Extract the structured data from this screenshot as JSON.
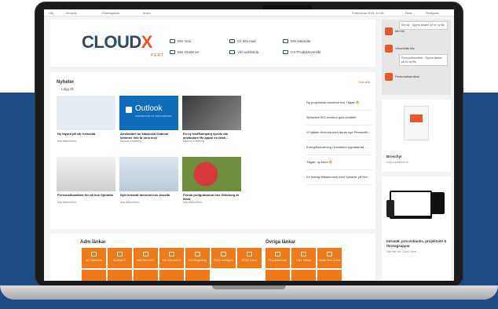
{
  "topbar": {
    "home": "Hej",
    "item1": "Intranät",
    "item2": "Företagsinfo",
    "item3": "Index",
    "right1": "Publicerad 2021-10-08",
    "right2": "Dela",
    "right3": "Redigera"
  },
  "header": {
    "logo_main": "CLOUD",
    "logo_x": "X",
    "logo_sub": "PERT",
    "quicklinks": [
      {
        "label": "Min mail",
        "icon": "mail-icon"
      },
      {
        "label": "Cli Info mail",
        "icon": "mail-icon"
      },
      {
        "label": "Min kalender",
        "icon": "calendar-icon"
      },
      {
        "label": "Min OneDrive",
        "icon": "cloud-icon"
      },
      {
        "label": "Vår webbsida",
        "icon": "globe-icon"
      },
      {
        "label": "CX Produktöversikt",
        "icon": "grid-icon"
      }
    ]
  },
  "news": {
    "title": "Nyheter",
    "add_label": "Lägg till",
    "see_all": "Visa alla",
    "tiles": [
      {
        "title": "Ny layout på vår hemsida",
        "author": "Mia Malmström",
        "img_color": "#dfe6ee"
      },
      {
        "title": "Användare av klassiska Outlook kommer inte år sina mejl",
        "author": "Marcus Eriksberg",
        "img_color": "#0f6cbd",
        "img_text": "Outlook",
        "img_sub": "CONNECTOR TO YOUR PEOPLE"
      },
      {
        "title": "En ny bloffkampanj sprids där användare får appar en falsk...",
        "author": "Marcus Eriksberg",
        "img_color": "#5a5a5a"
      },
      {
        "title": "Personalhandbok för nå hos Sjöradio",
        "author": "Mia Malmström",
        "img_color": "#d8d8d8"
      },
      {
        "title": "Nytt Intranät lanserat hos Assella",
        "author": "Mia Malmström",
        "img_color": "#cfdae6"
      },
      {
        "title": "Första jordgubbarna hos Göteborg är klara",
        "author": "Mia Malmström",
        "img_color": "#7a9a4a"
      }
    ],
    "list": [
      {
        "text": "Ny projektsida lanserad hos Tågab",
        "flame": true
      },
      {
        "text": "Sjöradios ISO-revision gick utmärkt!",
        "flame": false
      },
      {
        "text": "Vi hjälper Arsecka med deras nya Personalh...",
        "flame": false
      },
      {
        "text": "Energiförsvaltning i tomheten uppdaterad ...",
        "flame": false
      },
      {
        "text": "Tågab, ny kund",
        "flame": true
      },
      {
        "text": "En lodetgi tillsammans med Sjöradio på Net...",
        "flame": false
      }
    ]
  },
  "links": {
    "adm_title": "Adm länkar",
    "other_title": "Övriga länkar",
    "adm_buttons": [
      "AC Omnimini",
      "Kaxbata E.",
      "Mäk Service F.",
      "Min Ekonomi Z",
      "MX Omgedring",
      "FUXX Intelligent",
      "XCXX Cloud"
    ],
    "other_buttons": [
      "Projektall Data",
      "Fakt. Online",
      "Sbabe Mon & Anl."
    ]
  },
  "sidebar": {
    "item1": "Min tid",
    "tooltip1": "Min tid · Öppna länken på en ny flik",
    "item2": "Visselblås här",
    "tooltip2": "Personalhandbok · Öppna länken på en ny flik",
    "item3": "Personalhandbok",
    "brochure_title": "Broschyr",
    "brochure_sub": "cx@cloudxpert.se",
    "promo_title": "Intranät, procesbanks, projektsite & företagsappar",
    "promo_sub": "Läs mer om Cloud Xpert"
  }
}
